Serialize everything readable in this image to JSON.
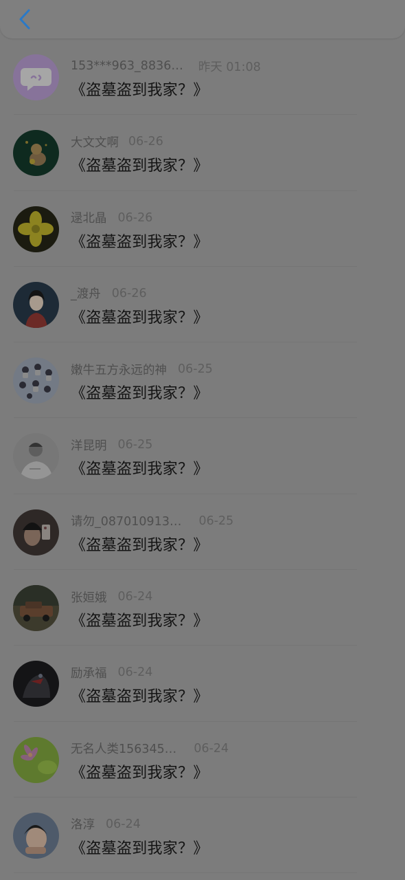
{
  "header": {
    "back_icon": "chevron-left-icon",
    "accent": "#2a79c7"
  },
  "items": [
    {
      "name": "153***963_8836…",
      "time": "昨天 01:08",
      "message": "《盗墓盗到我家？》",
      "avatar": "chat-bubble-avatar"
    },
    {
      "name": "大文文啊",
      "time": "06-26",
      "message": "《盗墓盗到我家？》",
      "avatar": "cartoon-figure-avatar"
    },
    {
      "name": "逯北晶",
      "time": "06-26",
      "message": "《盗墓盗到我家？》",
      "avatar": "yellow-flower-avatar"
    },
    {
      "name": "_渡舟",
      "time": "06-26",
      "message": "《盗墓盗到我家？》",
      "avatar": "girl-portrait-avatar"
    },
    {
      "name": "嫩牛五方永远的神",
      "time": "06-25",
      "message": "《盗墓盗到我家？》",
      "avatar": "chibi-characters-avatar"
    },
    {
      "name": "洋昆明",
      "time": "06-25",
      "message": "《盗墓盗到我家？》",
      "avatar": "man-white-shirt-avatar"
    },
    {
      "name": "请勿_087010913…",
      "time": "06-25",
      "message": "《盗墓盗到我家？》",
      "avatar": "mirror-selfie-avatar"
    },
    {
      "name": "张姮娥",
      "time": "06-24",
      "message": "《盗墓盗到我家？》",
      "avatar": "vintage-car-avatar"
    },
    {
      "name": "励承福",
      "time": "06-24",
      "message": "《盗墓盗到我家？》",
      "avatar": "masked-figure-avatar"
    },
    {
      "name": "无名人类156345…",
      "time": "06-24",
      "message": "《盗墓盗到我家？》",
      "avatar": "pink-flower-avatar"
    },
    {
      "name": "洛淳",
      "time": "06-24",
      "message": "《盗墓盗到我家？》",
      "avatar": "child-portrait-avatar"
    }
  ]
}
